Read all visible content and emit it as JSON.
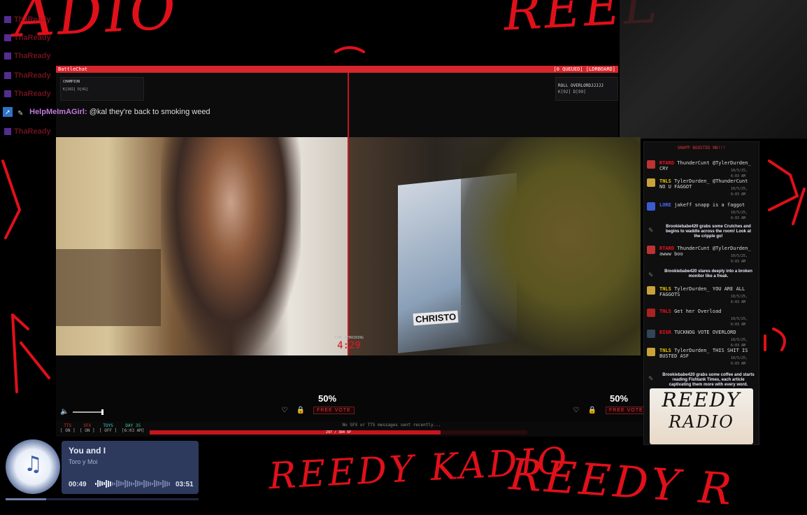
{
  "overlay": {
    "scribbles": {
      "tl": "ADIO",
      "tr": "REEL",
      "bottom_main": "REEDY KADIO",
      "bottom_right": "REEDY R"
    },
    "chat_names": [
      "ThaReady",
      "ThaReady",
      "ThaReady",
      "ThaReady",
      "ThaReady",
      "ThaReady"
    ],
    "highlight_message": {
      "user": "HelpMeImAGirl:",
      "text": "@kal they're back to smoking weed"
    }
  },
  "topbar": {
    "title": "BattleChat",
    "right_status": "[0 QUEUED] [LDRBOARD]"
  },
  "left_box": {
    "line1": "CHAMPION",
    "line2": "K[102] D[41]"
  },
  "right_box": {
    "line1": "ROLL OVERLORDJJJJJ",
    "line2": "K[92] D[99]"
  },
  "timer": {
    "label": "TIME REMAINING",
    "value": "4:29"
  },
  "panes": {
    "left": {
      "percent": "50%",
      "vote_label": "FREE VOTE"
    },
    "right": {
      "percent": "50%",
      "vote_label": "FREE VOTE",
      "banner": "CHRISTO"
    }
  },
  "sidebar": {
    "header": "SNAPP BOOSTED NN!!!",
    "entries": [
      {
        "tag": "RTARD",
        "tagc": "red",
        "text": "ThunderCunt @TylerDurden_ CRY",
        "ts": "10/5/25, 6:03 AM",
        "ava": "#b33"
      },
      {
        "tag": "TNLS",
        "tagc": "yel",
        "text": "TylerDurden_ @ThunderCunt NO U FAGGOT",
        "ts": "10/5/25, 6:03 AM",
        "ava": "#c9a23a"
      },
      {
        "tag": "LORE",
        "tagc": "blu",
        "text": "jakeff snapp is a faggot",
        "ts": "10/5/25, 6:03 AM",
        "ava": "#3a5bd0"
      },
      {
        "tag": "RTARD",
        "tagc": "red",
        "text": "ThunderCunt @TylerDurden_ awww boo",
        "ts": "10/5/25, 6:03 AM",
        "ava": "#b33"
      },
      {
        "tag": "TNLS",
        "tagc": "yel",
        "text": "TylerDurden_ YOU ARE ALL FAGGOTS",
        "ts": "10/5/25, 6:03 AM",
        "ava": "#c9a23a"
      },
      {
        "tag": "TNLS",
        "tagc": "red",
        "text": "Get her Overload",
        "ts": "10/5/25, 6:03 AM",
        "ava": "#a22"
      },
      {
        "tag": "BIGR",
        "tagc": "red",
        "text": "TUCKNOG VOTE OVERLORD",
        "ts": "10/5/25, 6:03 AM",
        "ava": "#345"
      },
      {
        "tag": "TNLS",
        "tagc": "yel",
        "text": "TylerDurden_ THIS SHIT IS BUSTED ASF",
        "ts": "10/5/25, 6:03 AM",
        "ava": "#c9a23a"
      }
    ],
    "narrations": [
      "Brookiebabe420 grabs some Crutches and begins to waddle across the room! Look at the cripple go!",
      "Brookiebabe420 stares deeply into a broken monitor like a freak.",
      "Brookiebabe420 grabs some coffee and starts reading Fishtank Times, each article captivating them more with every word."
    ],
    "logo_line1": "REEDY",
    "logo_line2": "RADIO"
  },
  "bottombar": {
    "labels": [
      "TTS",
      "SFX",
      "TOYS",
      "DAY 35"
    ],
    "values": [
      "[ ON ]",
      "[ ON ]",
      "[ OFF ]",
      "[6:03 AM]"
    ],
    "center_msg": "No SFX or TTS messages sent recently...",
    "xp": "297 / 384 XP",
    "progress": 0.77
  },
  "music": {
    "title": "You and I",
    "artist": "Toro y Moi",
    "elapsed": "00:49",
    "duration": "03:51",
    "progress": 0.21
  },
  "colors": {
    "accent": "#d6262c",
    "scribble": "#e0101a",
    "music_bg": "#2d3a5e"
  }
}
